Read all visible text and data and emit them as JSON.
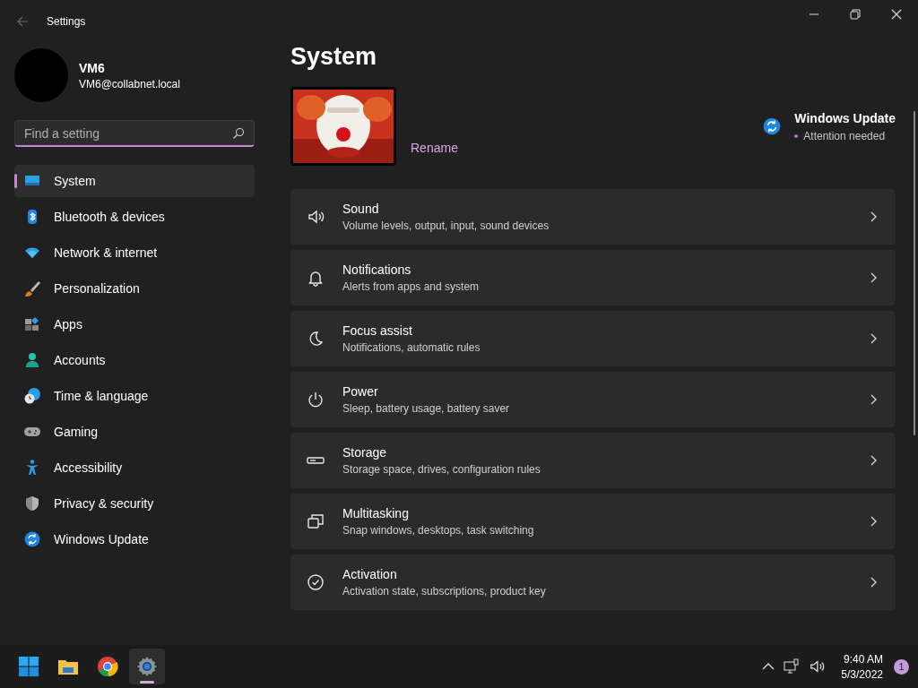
{
  "window": {
    "title": "Settings"
  },
  "profile": {
    "name": "VM6",
    "email": "VM6@collabnet.local"
  },
  "search": {
    "placeholder": "Find a setting"
  },
  "sidebar": {
    "items": [
      {
        "kind": "system",
        "label": "System",
        "selected": true
      },
      {
        "kind": "bluetooth",
        "label": "Bluetooth & devices",
        "selected": false
      },
      {
        "kind": "network",
        "label": "Network & internet",
        "selected": false
      },
      {
        "kind": "brush",
        "label": "Personalization",
        "selected": false
      },
      {
        "kind": "apps",
        "label": "Apps",
        "selected": false
      },
      {
        "kind": "accounts",
        "label": "Accounts",
        "selected": false
      },
      {
        "kind": "time",
        "label": "Time & language",
        "selected": false
      },
      {
        "kind": "gaming",
        "label": "Gaming",
        "selected": false
      },
      {
        "kind": "accessibility",
        "label": "Accessibility",
        "selected": false
      },
      {
        "kind": "privacy",
        "label": "Privacy & security",
        "selected": false
      },
      {
        "kind": "update",
        "label": "Windows Update",
        "selected": false
      }
    ]
  },
  "page": {
    "title": "System"
  },
  "device": {
    "action": "Rename"
  },
  "update_status": {
    "title": "Windows Update",
    "status": "Attention needed"
  },
  "settings": [
    {
      "kind": "sound",
      "title": "Sound",
      "description": "Volume levels, output, input, sound devices"
    },
    {
      "kind": "notifications",
      "title": "Notifications",
      "description": "Alerts from apps and system"
    },
    {
      "kind": "focus",
      "title": "Focus assist",
      "description": "Notifications, automatic rules"
    },
    {
      "kind": "power",
      "title": "Power",
      "description": "Sleep, battery usage, battery saver"
    },
    {
      "kind": "storage",
      "title": "Storage",
      "description": "Storage space, drives, configuration rules"
    },
    {
      "kind": "multitasking",
      "title": "Multitasking",
      "description": "Snap windows, desktops, task switching"
    },
    {
      "kind": "activation",
      "title": "Activation",
      "description": "Activation state, subscriptions, product key"
    }
  ],
  "taskbar": {
    "apps": [
      {
        "kind": "start",
        "selected": false
      },
      {
        "kind": "explorer",
        "selected": false
      },
      {
        "kind": "chrome",
        "selected": false
      },
      {
        "kind": "settings",
        "selected": true
      }
    ],
    "time": "9:40 AM",
    "date": "5/3/2022",
    "notification_count": "1"
  }
}
